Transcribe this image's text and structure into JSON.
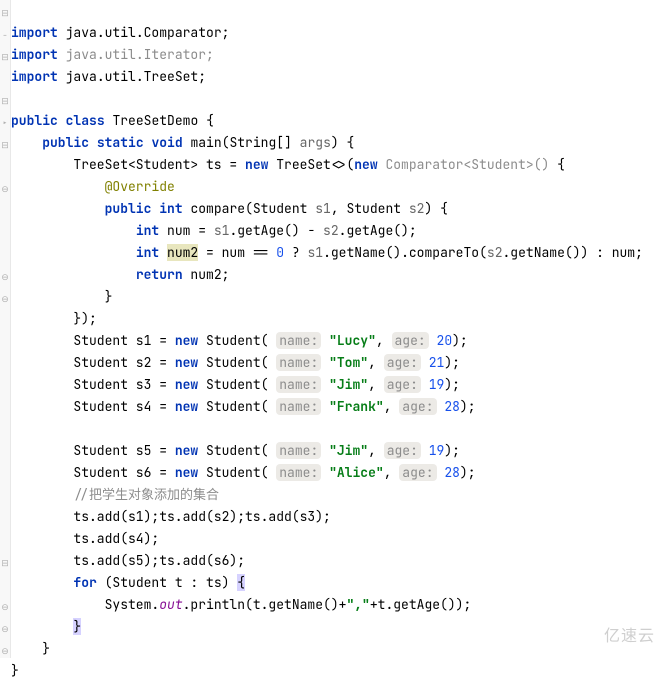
{
  "file": "TreeSetDemo.java",
  "imports": {
    "kw": "import",
    "a": "java.util.Comparator;",
    "b": "java.util.Iterator;",
    "c": "java.util.TreeSet;"
  },
  "cls": {
    "public": "public",
    "class": "class",
    "name": "TreeSetDemo",
    "open": " {"
  },
  "main": {
    "sig_pre": "public static void",
    "sig_name": " main(String[] ",
    "args": "args",
    "sig_post": ") {"
  },
  "tsdecl": {
    "a": "TreeSet<Student> ts = ",
    "new1": "new",
    "b": " TreeSet<>(",
    "new2": "new",
    "c": " ",
    "ctype": "Comparator<Student>()",
    "d": " {"
  },
  "override": "@Override",
  "cmp": {
    "public": "public",
    "int": "int",
    "a": " compare(Student ",
    "s1": "s1",
    "b": ", Student ",
    "s2": "s2",
    "c": ") {"
  },
  "l_num": {
    "int": "int",
    "a": " num = ",
    "s1": "s1",
    "b": ".getAge() - ",
    "s2": "s2",
    "c": ".getAge();"
  },
  "l_num2": {
    "int": "int",
    "var": "num2",
    "a": " = num == ",
    "zero": "0",
    "b": " ? ",
    "s1": "s1",
    "c": ".getName().compareTo(",
    "s2": "s2",
    "d": ".getName()) : num;"
  },
  "ret": {
    "kw": "return",
    "a": " num2;"
  },
  "brace_close1": "}",
  "anon_close": "});",
  "students": [
    {
      "idx": "1",
      "name": "\"Lucy\"",
      "age": "20"
    },
    {
      "idx": "2",
      "name": "\"Tom\"",
      "age": "21"
    },
    {
      "idx": "3",
      "name": "\"Jim\"",
      "age": "19"
    },
    {
      "idx": "4",
      "name": "\"Frank\"",
      "age": "28"
    },
    {
      "idx": "5",
      "name": "\"Jim\"",
      "age": "19"
    },
    {
      "idx": "6",
      "name": "\"Alice\"",
      "age": "28"
    }
  ],
  "hint_name": "name:",
  "hint_age": "age:",
  "comment": "//把学生对象添加的集合",
  "adds": {
    "l1": "ts.add(s1);ts.add(s2);ts.add(s3);",
    "l2": "ts.add(s4);",
    "l3": "ts.add(s5);ts.add(s6);"
  },
  "forloop": {
    "kw": "for",
    "a": " (Student t : ts) ",
    "brace": "{"
  },
  "println": {
    "a": "System.",
    "out": "out",
    "b": ".println(t.getName()+",
    "comma": "\",\"",
    "c": "+t.getAge());"
  },
  "brace_for_close": "}",
  "brace_main_close": "}",
  "brace_class_close": "}",
  "watermark": "亿速云",
  "decl_prefix": "Student s",
  "decl_eq": " = ",
  "decl_new": "new",
  "decl_stud": " Student( ",
  "decl_sep": ", ",
  "decl_end": ");"
}
